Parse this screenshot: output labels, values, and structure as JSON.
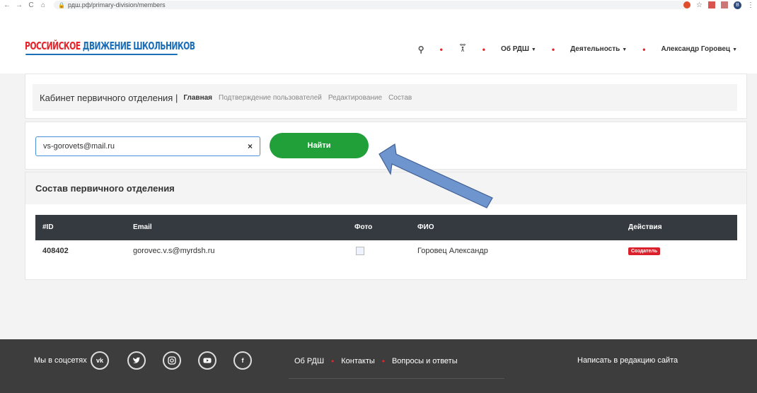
{
  "browser": {
    "url": "рдш.рф/primary-division/members",
    "back": "←",
    "forward": "→",
    "reload": "C",
    "home": "⌂",
    "profile": "В"
  },
  "header": {
    "logo_part1": "РОССИЙСКОЕ",
    "logo_part2": "ДВИЖЕНИЕ ШКОЛЬНИКОВ",
    "nav": {
      "search_icon": "search-icon",
      "about": "Об РДШ",
      "activity": "Деятельность",
      "user": "Александр Горовец"
    }
  },
  "cabinet": {
    "title": "Кабинет первичного отделения |",
    "links": [
      "Главная",
      "Подтверждение пользователей",
      "Редактирование",
      "Состав"
    ],
    "active": "Главная"
  },
  "search": {
    "value": "vs-gorovets@mail.ru",
    "clear": "×",
    "button": "Найти"
  },
  "members": {
    "title": "Состав первичного отделения",
    "columns": [
      "#ID",
      "Email",
      "Фото",
      "ФИО",
      "Действия"
    ],
    "rows": [
      {
        "id": "408402",
        "email": "gorovec.v.s@myrdsh.ru",
        "name": "Горовец Александр",
        "action": "Создатель"
      }
    ]
  },
  "footer": {
    "social_label": "Мы в соцсетях",
    "social": [
      "vk",
      "twitter",
      "instagram",
      "youtube",
      "f"
    ],
    "links": [
      "Об РДШ",
      "Контакты",
      "Вопросы и ответы"
    ],
    "write": "Написать в редакцию сайта"
  },
  "colors": {
    "accent_red": "#e4252c",
    "accent_blue": "#1d6fb8",
    "button_green": "#21a03a",
    "table_head": "#343a40",
    "arrow": "#6f95cf"
  }
}
